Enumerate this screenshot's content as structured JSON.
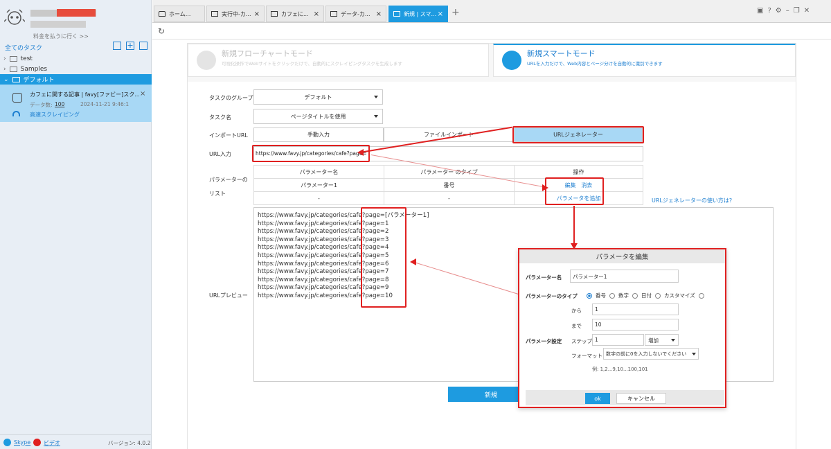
{
  "sidebar": {
    "username_masked": "▓▓▓▓",
    "pay_link": "料金を払うに行く >>",
    "all_tasks": "全てのタスク",
    "folders": [
      "test",
      "Samples",
      "デフォルト"
    ],
    "task": {
      "title": "カフェに関する記事 | favy[ファビー]スク...",
      "data_count_label": "データ数:",
      "data_count": "100",
      "datetime": "2024-11-21 9:46:1",
      "mode": "高速スクレイピング"
    },
    "footer": {
      "skype": "Skype",
      "video": "ビデオ",
      "version": "バージョン: 4.0.2"
    }
  },
  "tabs": [
    {
      "label": "ホーム..."
    },
    {
      "label": "実行中-カ..."
    },
    {
      "label": "カフェに..."
    },
    {
      "label": "データ-カ..."
    },
    {
      "label": "新規 | スマ..."
    }
  ],
  "modes": {
    "flowchart": {
      "title": "新規フローチャートモード",
      "desc": "可視化操作でWebサイトをクリックだけで、自動的にスクレイピングタスクを生成します"
    },
    "smart": {
      "title": "新規スマートモード",
      "desc": "URLを入力だけで、Web内容とページ分けを自動的に識別できます"
    }
  },
  "form": {
    "group_label": "タスクのグループ",
    "group_value": "デフォルト",
    "name_label": "タスク名",
    "name_value": "ページタイトルを使用",
    "import_label": "インポートURL",
    "import_options": [
      "手動入力",
      "ファイルインポート",
      "URLジェネレーター"
    ],
    "url_label": "URL入力",
    "url_value": "https://www.favy.jp/categories/cafe?page=",
    "param_list_label": "パラメーターのリスト",
    "param_headers": [
      "パラメーター名",
      "パラメーター のタイプ",
      "操作"
    ],
    "param_row": {
      "name": "パラメーター1",
      "type": "番号",
      "edit": "編集",
      "delete": "消去"
    },
    "param_row2": {
      "name": "-",
      "type": "-",
      "add": "パラメータを追加"
    },
    "help_link": "URLジェネレーターの使い方は?",
    "preview_label": "URLプレビュー",
    "preview_lines": [
      "https://www.favy.jp/categories/cafe?page=[パラメーター1]",
      "https://www.favy.jp/categories/cafe?page=1",
      "https://www.favy.jp/categories/cafe?page=2",
      "https://www.favy.jp/categories/cafe?page=3",
      "https://www.favy.jp/categories/cafe?page=4",
      "https://www.favy.jp/categories/cafe?page=5",
      "https://www.favy.jp/categories/cafe?page=6",
      "https://www.favy.jp/categories/cafe?page=7",
      "https://www.favy.jp/categories/cafe?page=8",
      "https://www.favy.jp/categories/cafe?page=9",
      "https://www.favy.jp/categories/cafe?page=10"
    ],
    "create_button": "新規"
  },
  "dialog": {
    "title": "パラメータを編集",
    "name_label": "パラメーター名",
    "name_value": "パラメーター1",
    "type_label": "パラメーターのタイプ",
    "type_options": [
      "番号",
      "数字",
      "日付",
      "カスタマイズ"
    ],
    "setting_label": "パラメータ設定",
    "from_label": "から",
    "from_value": "1",
    "to_label": "まで",
    "to_value": "10",
    "step_label": "ステップ",
    "step_value": "1",
    "step_mode": "増加",
    "format_label": "フォーマット",
    "format_value": "数字の前に0を入力しないでください",
    "example": "例: 1,2...9,10...100,101",
    "ok": "ok",
    "cancel": "キャンセル"
  },
  "colors": {
    "accent": "#1e9be0",
    "highlight": "#e02020",
    "selected_tab": "#a8d8f5"
  }
}
